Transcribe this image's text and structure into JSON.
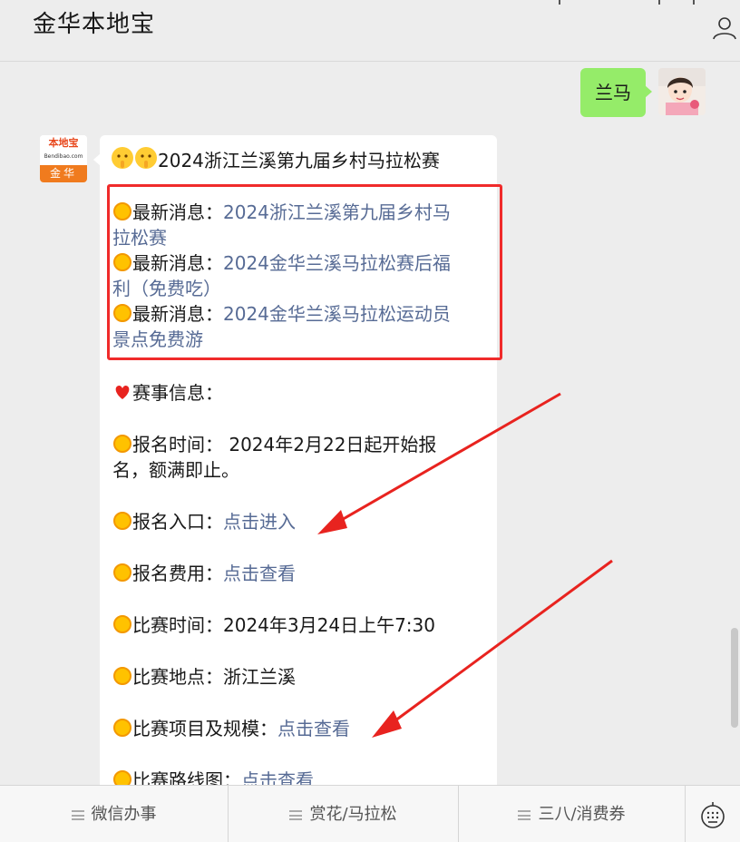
{
  "header": {
    "title": "金华本地宝"
  },
  "chat": {
    "user_message": "兰马",
    "bot": {
      "logo_top": "本地宝",
      "logo_sub": "Bendibao.com",
      "logo_bottom": "金华",
      "title": "2024浙江兰溪第九届乡村马拉松赛",
      "news_label": "最新消息：",
      "news": [
        {
          "line1": "2024浙江兰溪第九届乡村马",
          "line2": "拉松赛"
        },
        {
          "line1": "2024金华兰溪马拉松赛后福",
          "line2": "利（免费吃）"
        },
        {
          "line1": "2024金华兰溪马拉松运动员",
          "line2": "景点免费游"
        }
      ],
      "event_info_label": "赛事信息：",
      "reg_time_label": "报名时间：",
      "reg_time_value_1": " 2024年2月22日起开始报",
      "reg_time_value_2": "名，额满即止。",
      "reg_entry_label": "报名入口：",
      "reg_entry_link": "点击进入",
      "reg_fee_label": "报名费用：",
      "reg_fee_link": "点击查看",
      "race_time_label": "比赛时间：",
      "race_time_value": "2024年3月24日上午7:30",
      "race_place_label": "比赛地点：",
      "race_place_value": "浙江兰溪",
      "race_items_label": "比赛项目及规模：",
      "race_items_link": "点击查看",
      "route_label": "比赛路线图：",
      "route_link": "点击查看"
    }
  },
  "bottom_menu": {
    "items": [
      "微信办事",
      "赏花/马拉松",
      "三八/消费券"
    ]
  },
  "colors": {
    "link": "#576b95",
    "user_bubble": "#95ec69",
    "highlight": "#f02b2b",
    "arrow": "#e8231f"
  },
  "icons": [
    "profile-icon",
    "sun-emoji-icon",
    "heart-emoji-icon",
    "shush-emoji-icon",
    "menu-icon",
    "keyboard-icon"
  ]
}
